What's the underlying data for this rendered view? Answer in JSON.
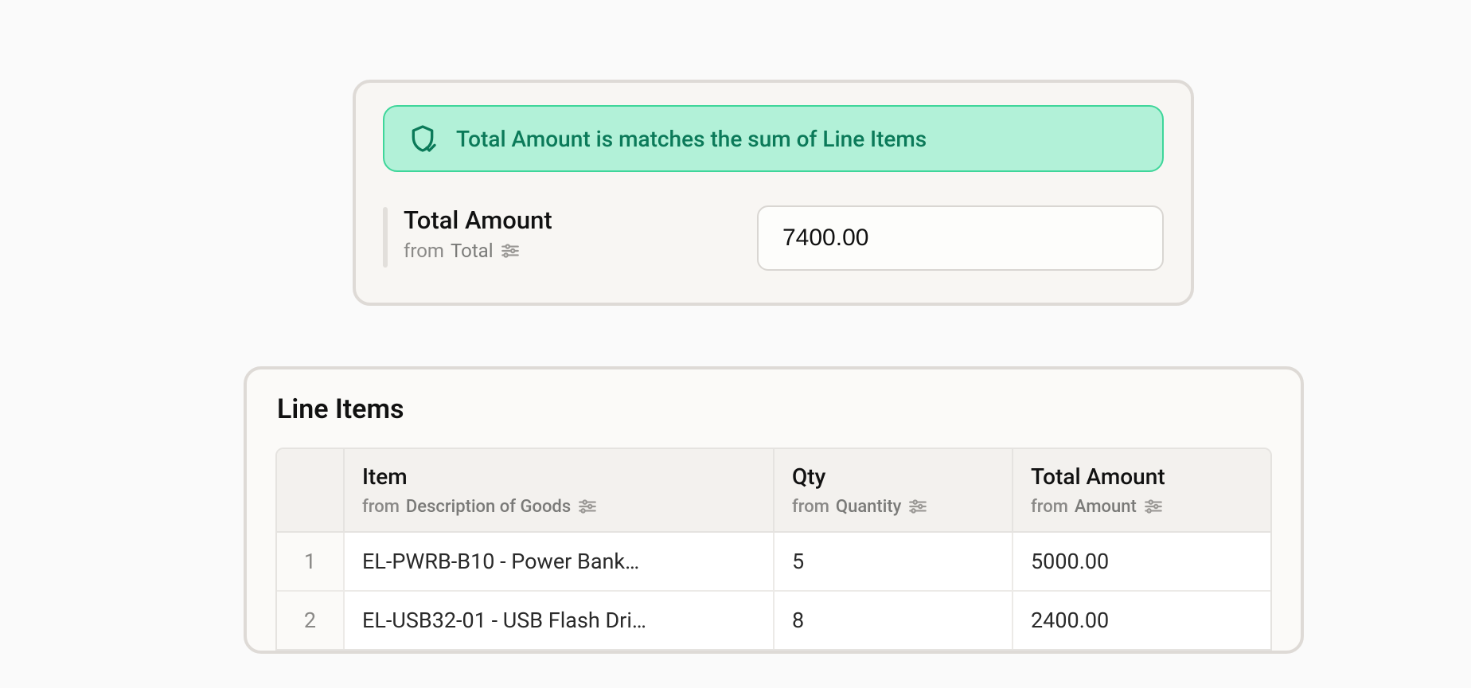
{
  "alert": {
    "message": "Total Amount is matches the sum of Line Items"
  },
  "total_field": {
    "label": "Total Amount",
    "from_prefix": "from",
    "source": "Total",
    "value": "7400.00"
  },
  "line_items": {
    "title": "Line Items",
    "columns": {
      "item": {
        "label": "Item",
        "from_prefix": "from",
        "source": "Description of Goods"
      },
      "qty": {
        "label": "Qty",
        "from_prefix": "from",
        "source": "Quantity"
      },
      "amount": {
        "label": "Total Amount",
        "from_prefix": "from",
        "source": "Amount"
      }
    },
    "rows": [
      {
        "idx": "1",
        "item": "EL-PWRB-B10 - Power Bank…",
        "qty": "5",
        "amount": "5000.00"
      },
      {
        "idx": "2",
        "item": "EL-USB32-01 - USB Flash Dri…",
        "qty": "8",
        "amount": "2400.00"
      }
    ]
  }
}
